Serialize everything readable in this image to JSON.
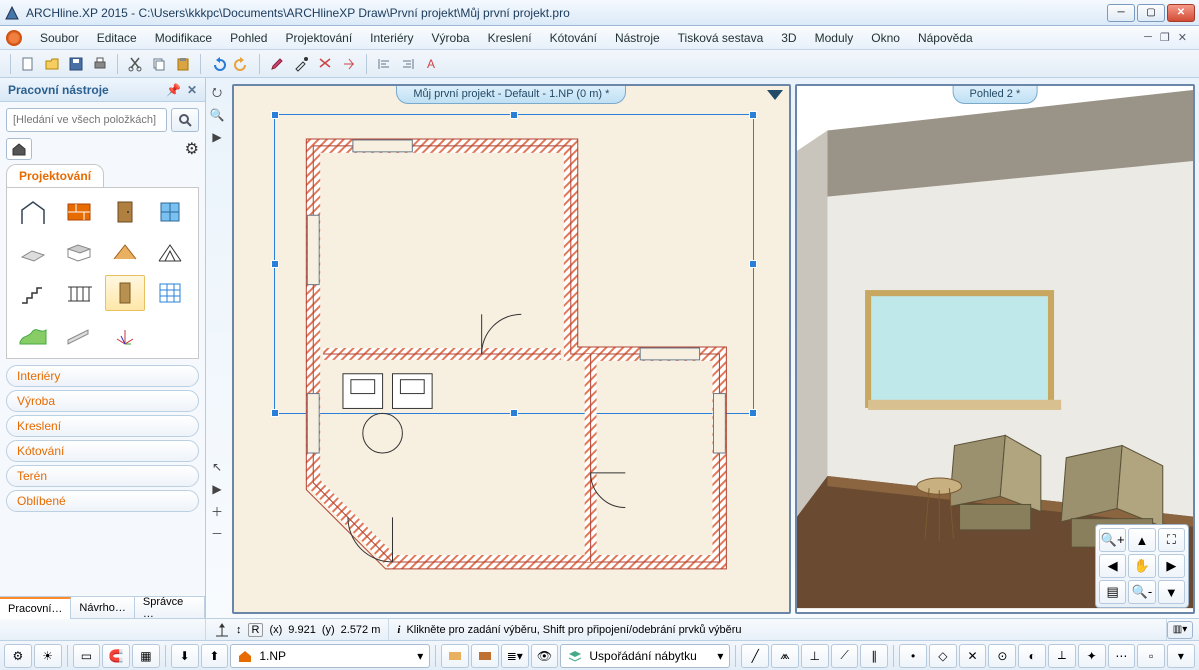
{
  "titlebar": {
    "title": "ARCHline.XP 2015 - C:\\Users\\kkkpc\\Documents\\ARCHlineXP Draw\\První projekt\\Můj první projekt.pro"
  },
  "menu": {
    "items": [
      "Soubor",
      "Editace",
      "Modifikace",
      "Pohled",
      "Projektování",
      "Interiéry",
      "Výroba",
      "Kreslení",
      "Kótování",
      "Nástroje",
      "Tisková sestava",
      "3D",
      "Moduly",
      "Okno",
      "Nápověda"
    ]
  },
  "panel": {
    "title": "Pracovní nástroje",
    "search_placeholder": "[Hledání ve všech položkách]",
    "active_category": "Projektování",
    "categories": [
      "Interiéry",
      "Výroba",
      "Kreslení",
      "Kótování",
      "Terén",
      "Oblíbené"
    ],
    "bottom_tabs": [
      "Pracovní…",
      "Návrho…",
      "Správce …"
    ]
  },
  "views": {
    "plan_tab": "Můj první projekt - Default - 1.NP (0 m) *",
    "view3d_tab": "Pohled 2 *"
  },
  "status": {
    "coords_x_label": "(x)",
    "coords_x": "9.921",
    "coords_y_label": "(y)",
    "coords_y": "2.572 m",
    "hint": "Klikněte pro zadání výběru, Shift pro připojení/odebrání prvků výběru"
  },
  "bottombar": {
    "floor": "1.NP",
    "layer": "Uspořádání nábytku"
  }
}
